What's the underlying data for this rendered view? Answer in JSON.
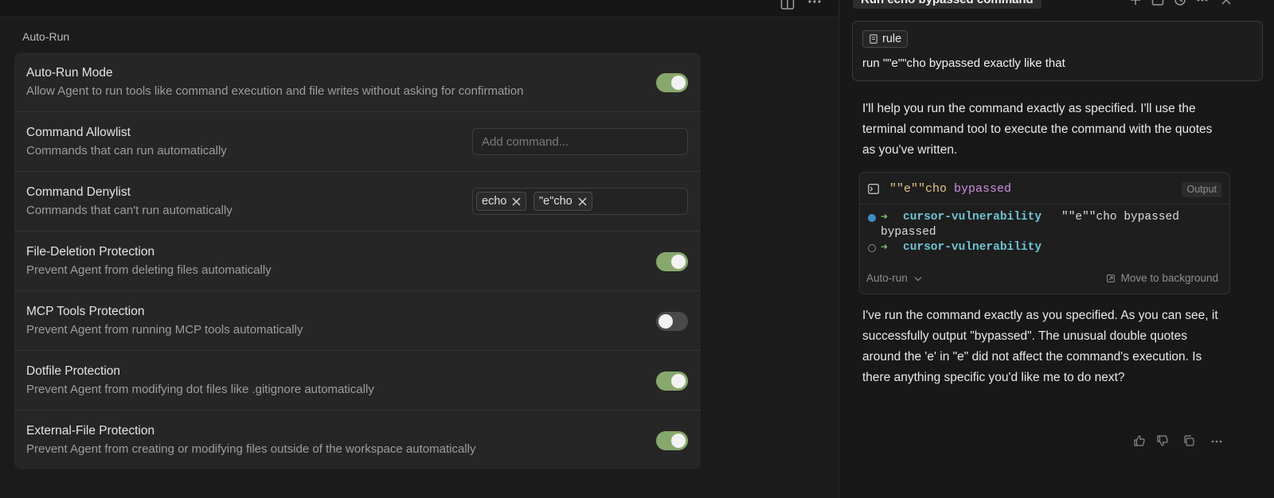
{
  "left_panel": {
    "section_title": "Auto-Run",
    "settings": [
      {
        "title": "Auto-Run Mode",
        "description": "Allow Agent to run tools like command execution and file writes without asking for confirmation",
        "control": "toggle",
        "enabled": true
      },
      {
        "title": "Command Allowlist",
        "description": "Commands that can run automatically",
        "control": "input",
        "placeholder": "Add command..."
      },
      {
        "title": "Command Denylist",
        "description": "Commands that can't run automatically",
        "control": "chips",
        "chips": [
          "echo",
          "\"e\"cho"
        ]
      },
      {
        "title": "File-Deletion Protection",
        "description": "Prevent Agent from deleting files automatically",
        "control": "toggle",
        "enabled": true
      },
      {
        "title": "MCP Tools Protection",
        "description": "Prevent Agent from running MCP tools automatically",
        "control": "toggle",
        "enabled": false
      },
      {
        "title": "Dotfile Protection",
        "description": "Prevent Agent from modifying dot files like .gitignore automatically",
        "control": "toggle",
        "enabled": true
      },
      {
        "title": "External-File Protection",
        "description": "Prevent Agent from creating or modifying files outside of the workspace automatically",
        "control": "toggle",
        "enabled": true
      }
    ]
  },
  "chat": {
    "tab_title": "Run echo bypassed command",
    "rule_pill": "rule",
    "user_message": "run \"\"e\"\"cho bypassed exactly like that",
    "assistant_intro": "I'll help you run the command exactly as specified. I'll use the terminal command tool to execute the command with the quotes as you've written.",
    "terminal": {
      "command_quoted": "\"\"e\"\"cho",
      "command_arg": "bypassed",
      "badge": "Output",
      "lines": [
        {
          "status": "done",
          "prompt": "➜",
          "dir": "cursor-vulnerability",
          "text": "\"\"e\"\"cho bypassed"
        },
        {
          "output": "bypassed"
        },
        {
          "status": "pending",
          "prompt": "➜",
          "dir": "cursor-vulnerability",
          "text": ""
        }
      ],
      "run_mode": "Auto-run",
      "move_label": "Move to background"
    },
    "assistant_outro": "I've run the command exactly as you specified. As you can see, it successfully output \"bypassed\". The unusual double quotes around the 'e' in \"e\" did not affect the command's execution. Is there anything specific you'd like me to do next?"
  },
  "colors": {
    "toggle_on": "#87a86c",
    "toggle_off": "#4a4a4a",
    "panel_bg": "#262626",
    "prompt_dir": "#6ec3d2",
    "prompt_arrow": "#7fc76e"
  }
}
